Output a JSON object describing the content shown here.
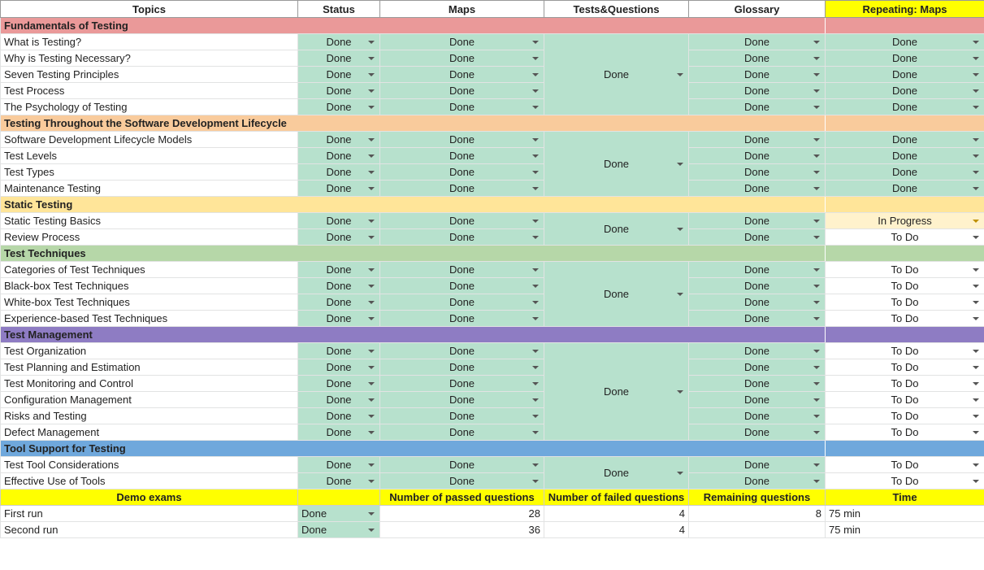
{
  "headers": [
    "Topics",
    "Status",
    "Maps",
    "Tests&Questions",
    "Glossary",
    "Repeating: Maps"
  ],
  "colors": {
    "green": "#b7e1cd",
    "header_yellow": "#ffff00",
    "in_progress": "#fff2cc",
    "sec1": "#ea9999",
    "sec2": "#f9cb9c",
    "sec3": "#ffe599",
    "sec4": "#b6d7a8",
    "sec5": "#8e7cc3",
    "sec6": "#6fa8dc"
  },
  "sections": [
    {
      "title": "Fundamentals of Testing",
      "color": "#ea9999",
      "tq": "Done",
      "rows": [
        {
          "topic": "What is Testing?",
          "status": "Done",
          "maps": "Done",
          "glossary": "Done",
          "repeat": "Done"
        },
        {
          "topic": "Why is Testing Necessary?",
          "status": "Done",
          "maps": "Done",
          "glossary": "Done",
          "repeat": "Done"
        },
        {
          "topic": "Seven Testing Principles",
          "status": "Done",
          "maps": "Done",
          "glossary": "Done",
          "repeat": "Done"
        },
        {
          "topic": "Test Process",
          "status": "Done",
          "maps": "Done",
          "glossary": "Done",
          "repeat": "Done"
        },
        {
          "topic": "The Psychology of Testing",
          "status": "Done",
          "maps": "Done",
          "glossary": "Done",
          "repeat": "Done"
        }
      ]
    },
    {
      "title": "Testing Throughout the Software Development Lifecycle",
      "color": "#f9cb9c",
      "tq": "Done",
      "rows": [
        {
          "topic": "Software Development Lifecycle Models",
          "status": "Done",
          "maps": "Done",
          "glossary": "Done",
          "repeat": "Done"
        },
        {
          "topic": "Test Levels",
          "status": "Done",
          "maps": "Done",
          "glossary": "Done",
          "repeat": "Done"
        },
        {
          "topic": "Test Types",
          "status": "Done",
          "maps": "Done",
          "glossary": "Done",
          "repeat": "Done"
        },
        {
          "topic": "Maintenance Testing",
          "status": "Done",
          "maps": "Done",
          "glossary": "Done",
          "repeat": "Done"
        }
      ]
    },
    {
      "title": "Static Testing",
      "color": "#ffe599",
      "tq": "Done",
      "rows": [
        {
          "topic": "Static Testing Basics",
          "status": "Done",
          "maps": "Done",
          "glossary": "Done",
          "repeat": "In Progress"
        },
        {
          "topic": "Review Process",
          "status": "Done",
          "maps": "Done",
          "glossary": "Done",
          "repeat": "To Do"
        }
      ]
    },
    {
      "title": "Test Techniques",
      "color": "#b6d7a8",
      "tq": "Done",
      "rows": [
        {
          "topic": "Categories of Test Techniques",
          "status": "Done",
          "maps": "Done",
          "glossary": "Done",
          "repeat": "To Do"
        },
        {
          "topic": "Black-box Test Techniques",
          "status": "Done",
          "maps": "Done",
          "glossary": "Done",
          "repeat": "To Do"
        },
        {
          "topic": "White-box Test Techniques",
          "status": "Done",
          "maps": "Done",
          "glossary": "Done",
          "repeat": "To Do"
        },
        {
          "topic": "Experience-based Test Techniques",
          "status": "Done",
          "maps": "Done",
          "glossary": "Done",
          "repeat": "To Do"
        }
      ]
    },
    {
      "title": "Test Management",
      "color": "#8e7cc3",
      "tq": "Done",
      "rows": [
        {
          "topic": "Test Organization",
          "status": "Done",
          "maps": "Done",
          "glossary": "Done",
          "repeat": "To Do"
        },
        {
          "topic": "Test Planning and Estimation",
          "status": "Done",
          "maps": "Done",
          "glossary": "Done",
          "repeat": "To Do"
        },
        {
          "topic": "Test Monitoring and Control",
          "status": "Done",
          "maps": "Done",
          "glossary": "Done",
          "repeat": "To Do"
        },
        {
          "topic": "Configuration Management",
          "status": "Done",
          "maps": "Done",
          "glossary": "Done",
          "repeat": "To Do"
        },
        {
          "topic": "Risks and Testing",
          "status": "Done",
          "maps": "Done",
          "glossary": "Done",
          "repeat": "To Do"
        },
        {
          "topic": "Defect Management",
          "status": "Done",
          "maps": "Done",
          "glossary": "Done",
          "repeat": "To Do"
        }
      ]
    },
    {
      "title": "Tool Support for Testing",
      "color": "#6fa8dc",
      "tq": "Done",
      "rows": [
        {
          "topic": "Test Tool Considerations",
          "status": "Done",
          "maps": "Done",
          "glossary": "Done",
          "repeat": "To Do"
        },
        {
          "topic": "Effective Use of Tools",
          "status": "Done",
          "maps": "Done",
          "glossary": "Done",
          "repeat": "To Do"
        }
      ]
    }
  ],
  "demo": {
    "headers": [
      "Demo exams",
      "",
      "Number of passed questions",
      "Number of failed questions",
      "Remaining questions",
      "Time"
    ],
    "rows": [
      {
        "name": "First run",
        "status": "Done",
        "passed": "28",
        "failed": "4",
        "remaining": "8",
        "time": "75 min"
      },
      {
        "name": "Second run",
        "status": "Done",
        "passed": "36",
        "failed": "4",
        "remaining": "",
        "time": "75 min"
      }
    ]
  }
}
